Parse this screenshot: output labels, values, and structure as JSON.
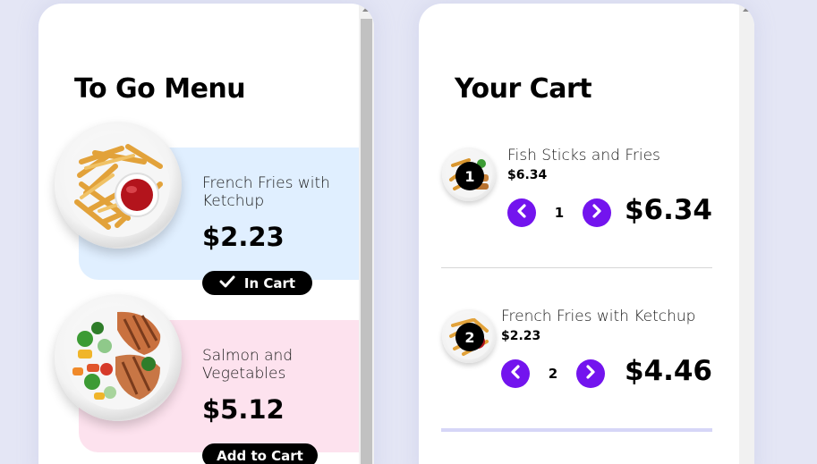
{
  "menu": {
    "title": "To Go Menu",
    "items": [
      {
        "name": "French Fries with Ketchup",
        "price": "$2.23",
        "button_label": "In Cart",
        "in_cart": true,
        "card_color": "#e0efff"
      },
      {
        "name": "Salmon and Vegetables",
        "price": "$5.12",
        "button_label": "Add to Cart",
        "in_cart": false,
        "card_color": "#fde2ee"
      }
    ]
  },
  "cart": {
    "title": "Your Cart",
    "items": [
      {
        "badge": "1",
        "name": "Fish Sticks and Fries",
        "unit_price": "$6.34",
        "quantity": "1",
        "line_total": "$6.34"
      },
      {
        "badge": "2",
        "name": "French Fries with Ketchup",
        "unit_price": "$2.23",
        "quantity": "2",
        "line_total": "$4.46"
      }
    ]
  },
  "colors": {
    "accent": "#7314ee",
    "background": "#e4e6f5"
  },
  "icons": {
    "check": "check-icon",
    "decrement": "chevron-left-icon",
    "increment": "chevron-right-icon"
  }
}
